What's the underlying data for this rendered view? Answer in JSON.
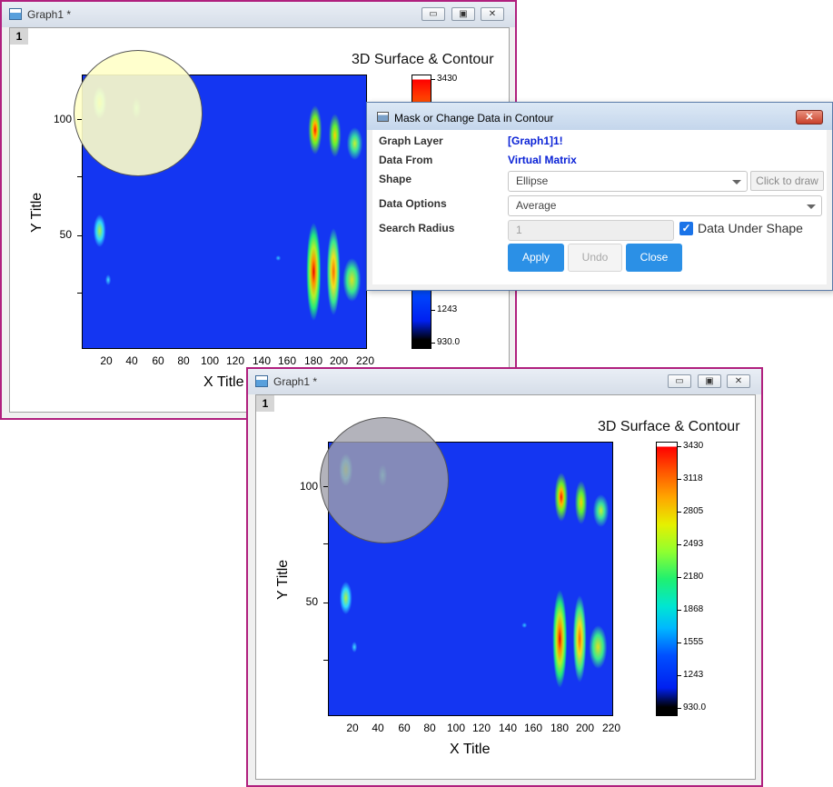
{
  "window1": {
    "title": "Graph1 *",
    "layer": "1",
    "plot_title": "3D Surface & Contour",
    "xlabel": "X Title",
    "ylabel": "Y Title",
    "y_ticks": [
      "100",
      "50"
    ],
    "x_ticks": [
      "20",
      "40",
      "60",
      "80",
      "100",
      "120",
      "140",
      "160",
      "180",
      "200",
      "220"
    ],
    "colorbar_labels": [
      "3430",
      "1243",
      "930.0"
    ]
  },
  "window2": {
    "title": "Graph1 *",
    "layer": "1",
    "plot_title": "3D Surface & Contour",
    "xlabel": "X Title",
    "ylabel": "Y Title",
    "y_ticks": [
      "100",
      "50"
    ],
    "x_ticks": [
      "20",
      "40",
      "60",
      "80",
      "100",
      "120",
      "140",
      "160",
      "180",
      "200",
      "220"
    ],
    "colorbar_labels": [
      "3430",
      "3118",
      "2805",
      "2493",
      "2180",
      "1868",
      "1555",
      "1243",
      "930.0"
    ]
  },
  "window_buttons": {
    "minimize": "▭",
    "restore": "▣",
    "close": "✕"
  },
  "dialog": {
    "title": "Mask or Change Data in Contour",
    "close_symbol": "✕",
    "labels": {
      "graph_layer": "Graph Layer",
      "data_from": "Data From",
      "shape": "Shape",
      "data_options": "Data Options",
      "search_radius": "Search Radius"
    },
    "values": {
      "graph_layer": "[Graph1]1!",
      "data_from": "Virtual Matrix"
    },
    "shape_selected": "Ellipse",
    "click_to_draw": "Click to draw",
    "data_options_selected": "Average",
    "search_radius_value": "1",
    "data_under_shape_label": "Data Under Shape",
    "data_under_shape_checked": true,
    "check_mark": "✓",
    "buttons": {
      "apply": "Apply",
      "undo": "Undo",
      "close": "Close"
    }
  },
  "colors": {
    "window_border": "#b0207e",
    "contour_background": "#1436f2",
    "dialog_value": "#0a22d6",
    "primary_button": "#2b90e6"
  }
}
